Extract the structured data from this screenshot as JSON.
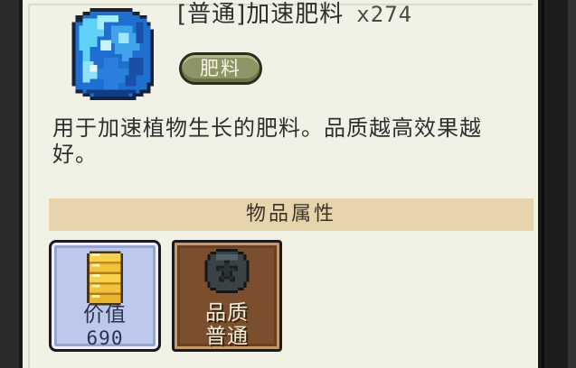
{
  "item": {
    "title": "[普通]加速肥料",
    "quantity": "x274",
    "tag": "肥料",
    "description": "用于加速植物生长的肥料。品质越高效果越好。",
    "icon": "blue-crystal-fertilizer-icon"
  },
  "attributes": {
    "header": "物品属性",
    "value_card": {
      "label": "价值",
      "value": "690",
      "icon": "gold-coin-stack-icon",
      "color": "#bcc8ec"
    },
    "quality_card": {
      "label": "品质",
      "value": "普通",
      "icon": "grey-star-medal-icon",
      "color": "#7b4e2d"
    }
  },
  "colors": {
    "panel_bg": "#f2f1e6",
    "section_header_bg": "#e6d4ad",
    "tag_bg": "#8f9466"
  }
}
